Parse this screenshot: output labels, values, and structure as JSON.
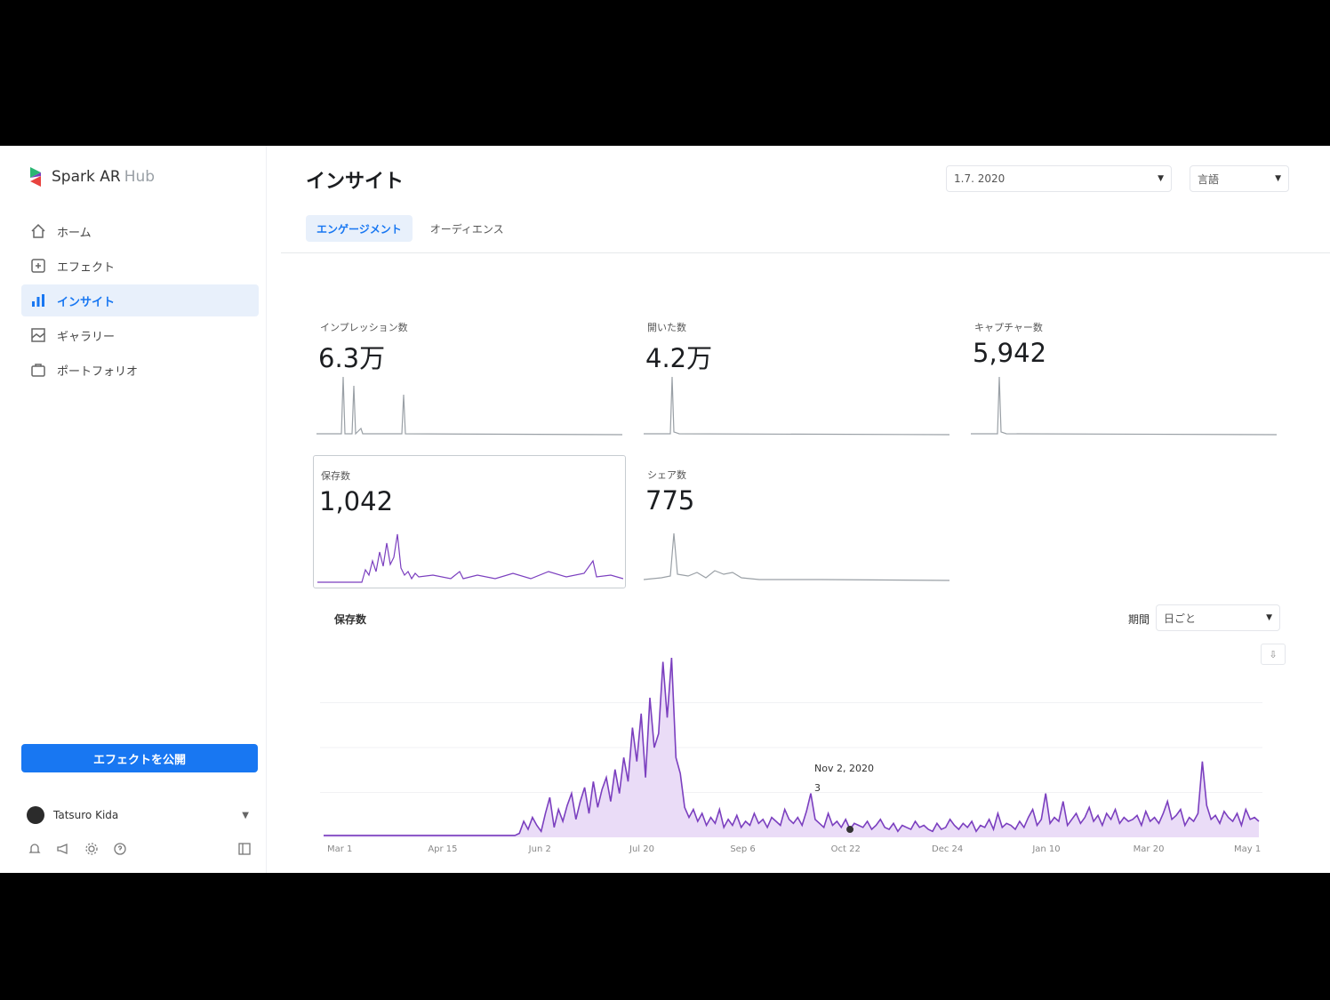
{
  "sidebar": {
    "brand": "Spark AR",
    "brand_sub": "Hub",
    "items": [
      {
        "label": "ホーム",
        "icon": "home-icon"
      },
      {
        "label": "エフェクト",
        "icon": "effects-icon"
      },
      {
        "label": "インサイト",
        "icon": "insights-icon",
        "active": true
      },
      {
        "label": "ギャラリー",
        "icon": "gallery-icon"
      },
      {
        "label": "ポートフォリオ",
        "icon": "portfolio-icon"
      }
    ],
    "upload_button": "エフェクトを公開",
    "user_name": "Tatsuro Kida"
  },
  "header": {
    "title": "インサイト",
    "date_range": "1.7. 2020",
    "language": "言語"
  },
  "tabs": [
    "エンゲージメント",
    "オーディエンス"
  ],
  "metrics": [
    {
      "label": "インプレッション数",
      "value": "6.3万"
    },
    {
      "label": "開いた数",
      "value": "4.2万"
    },
    {
      "label": "キャプチャー数",
      "value": "5,942"
    },
    {
      "label": "保存数",
      "value": "1,042",
      "selected": true
    },
    {
      "label": "シェア数",
      "value": "775"
    }
  ],
  "detail": {
    "title": "保存数",
    "period_label": "期間",
    "period_value": "日ごと",
    "tooltip_date": "Nov 2, 2020",
    "tooltip_value": "3"
  },
  "colors": {
    "accent": "#1877f2",
    "series": "#7b3fbf",
    "series_fill": "#eadcf7",
    "sparkline_gray": "#9aa0a6"
  },
  "chart_data": {
    "type": "area",
    "title": "保存数",
    "x_ticks": [
      "Mar 1",
      "Apr 15",
      "Jun 2",
      "Jul 20",
      "Sep 6",
      "Oct 22",
      "Dec 24",
      "Jan 10",
      "Mar 20",
      "May 1"
    ],
    "series": [
      {
        "values": [
          1,
          1,
          1,
          1,
          1,
          1,
          1,
          1,
          1,
          1,
          1,
          1,
          1,
          1,
          1,
          1,
          1,
          1,
          1,
          1,
          1,
          1,
          1,
          1,
          1,
          1,
          1,
          1,
          1,
          1,
          1,
          1,
          1,
          1,
          1,
          1,
          1,
          1,
          1,
          1,
          1,
          1,
          1,
          1,
          1,
          2,
          8,
          4,
          10,
          6,
          3,
          12,
          20,
          5,
          14,
          8,
          16,
          22,
          9,
          18,
          25,
          12,
          28,
          15,
          24,
          30,
          18,
          34,
          22,
          40,
          28,
          55,
          38,
          62,
          30,
          70,
          45,
          52,
          88,
          60,
          90,
          40,
          32,
          15,
          10,
          14,
          8,
          12,
          6,
          10,
          7,
          14,
          5,
          9,
          6,
          11,
          5,
          8,
          6,
          12,
          7,
          9,
          5,
          10,
          8,
          6,
          14,
          9,
          7,
          10,
          6,
          13,
          22,
          9,
          7,
          5,
          12,
          6,
          8,
          5,
          9,
          4,
          7,
          6,
          5,
          8,
          4,
          6,
          9,
          5,
          4,
          7,
          3,
          6,
          5,
          4,
          8,
          5,
          6,
          4,
          3,
          7,
          4,
          5,
          9,
          6,
          4,
          7,
          5,
          8,
          3,
          6,
          5,
          9,
          4,
          12,
          5,
          7,
          6,
          4,
          8,
          5,
          10,
          14,
          6,
          9,
          22,
          7,
          10,
          8,
          18,
          6,
          9,
          12,
          7,
          10,
          15,
          8,
          11,
          6,
          12,
          9,
          14,
          7,
          10,
          8,
          9,
          11,
          6,
          13,
          8,
          10,
          7,
          12,
          18,
          9,
          11,
          14,
          6,
          10,
          8,
          12,
          38,
          16,
          9,
          11,
          7,
          13,
          10,
          8,
          12,
          6,
          14,
          9,
          10,
          8
        ]
      }
    ]
  }
}
